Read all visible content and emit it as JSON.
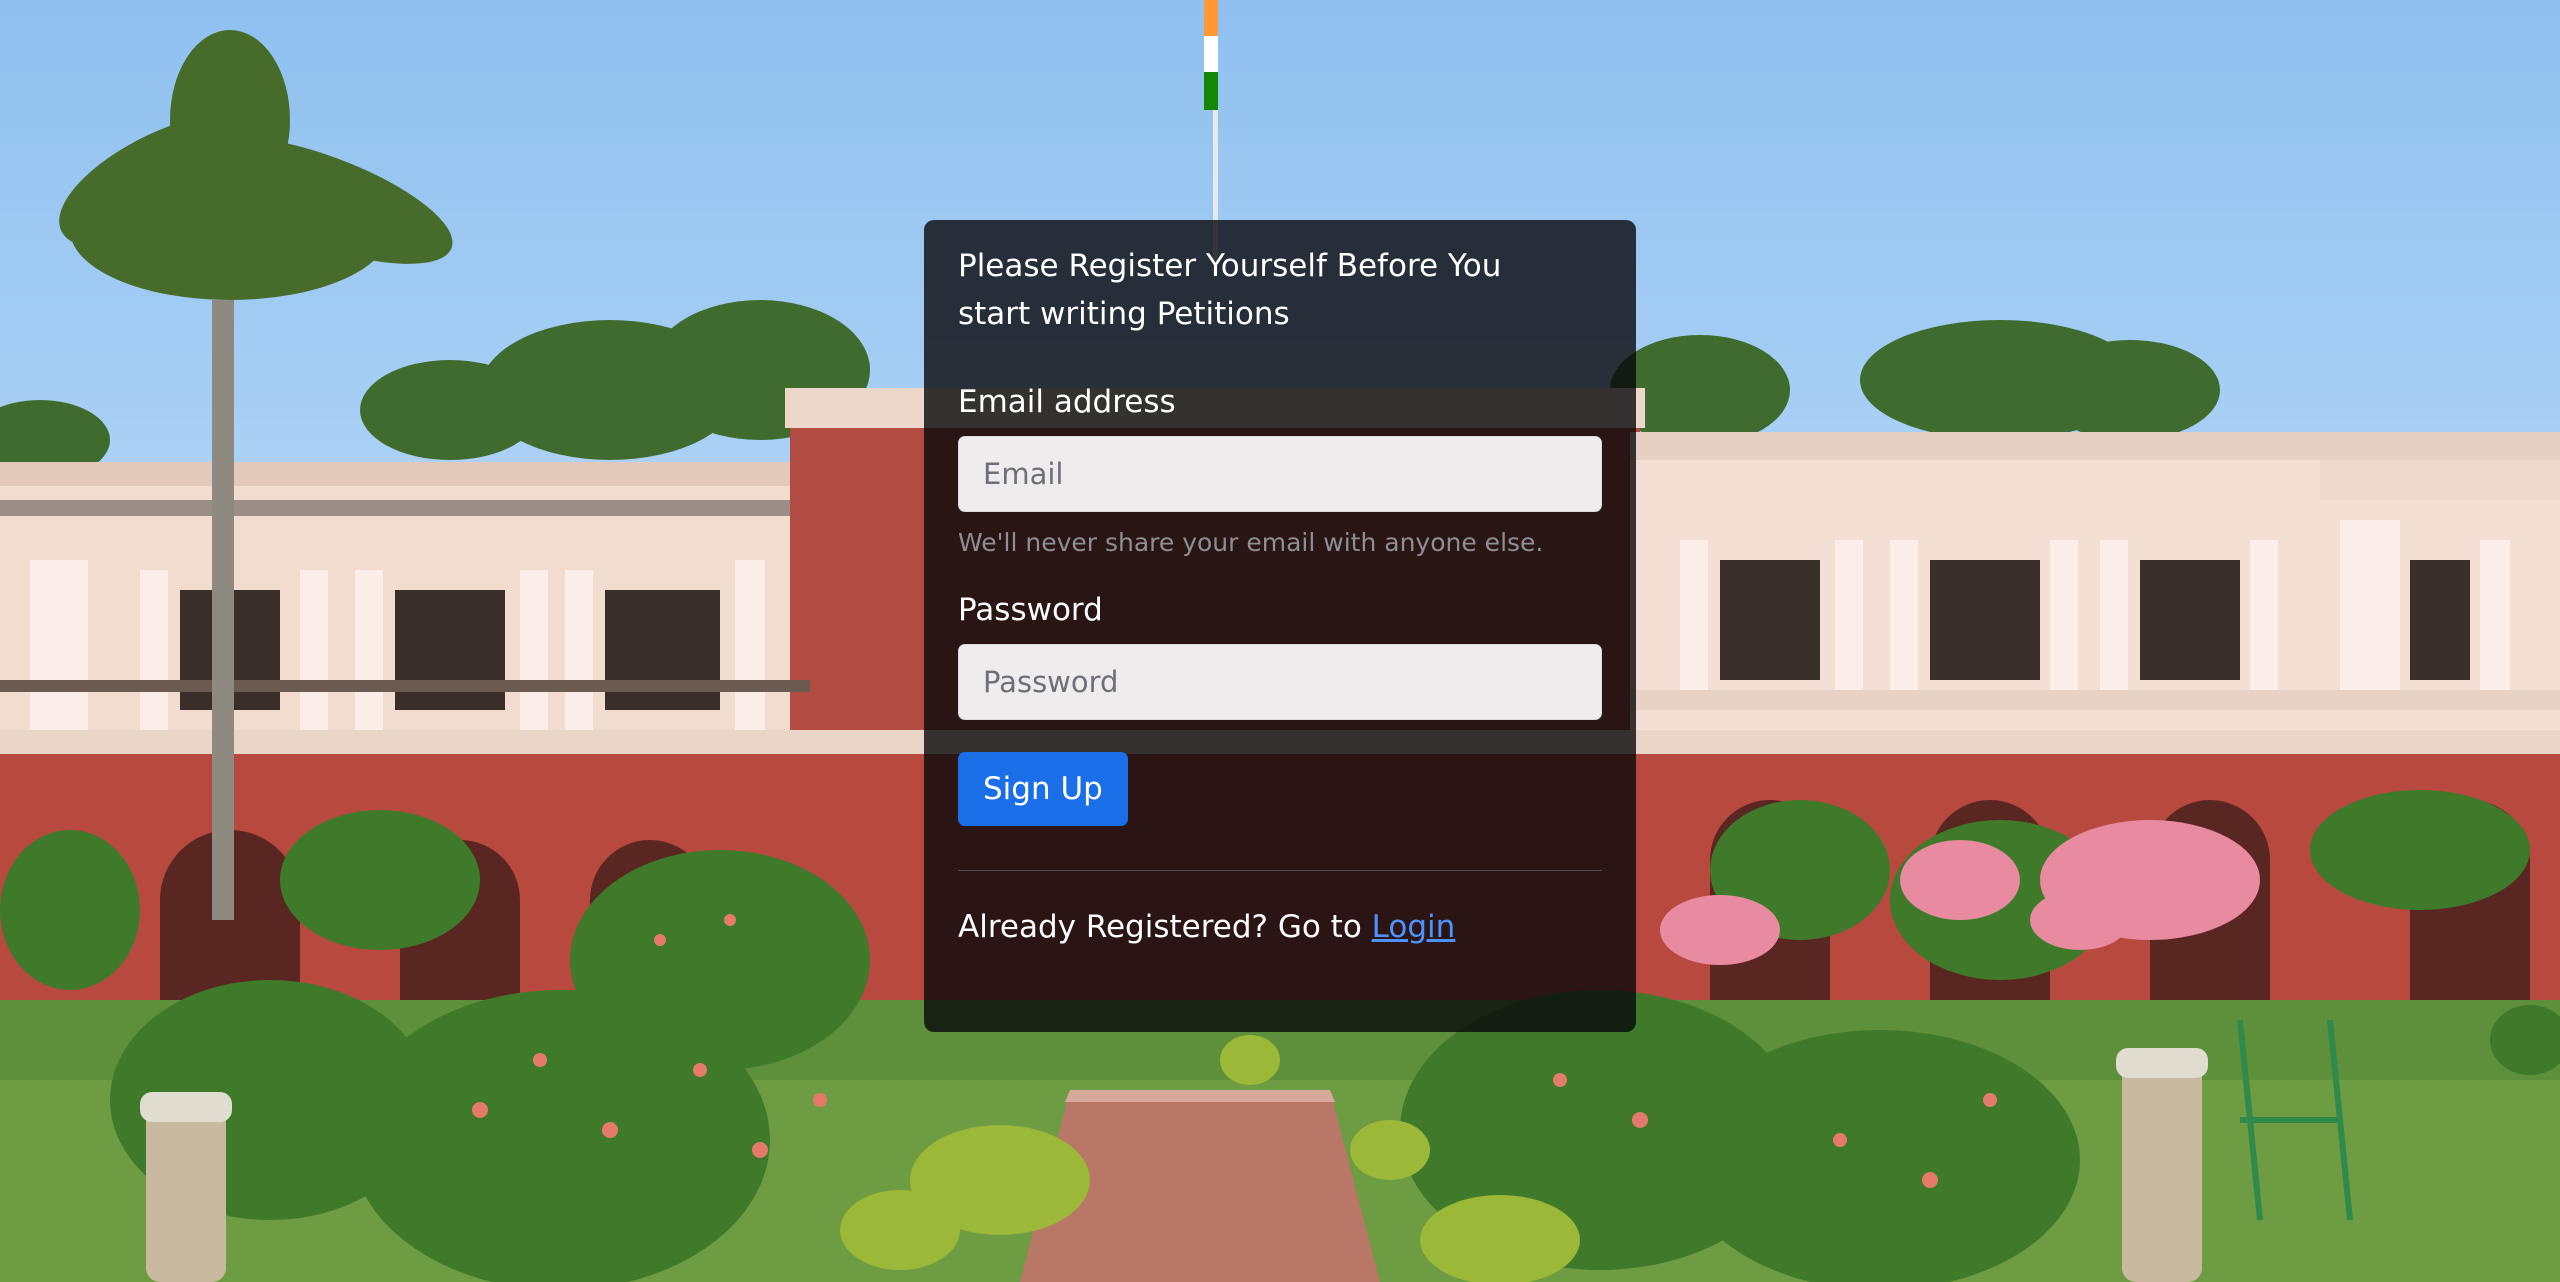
{
  "card": {
    "heading": "Please Register Yourself Before You start writing Petitions"
  },
  "form": {
    "email_label": "Email address",
    "email_placeholder": "Email",
    "email_value": "",
    "email_help": "We'll never share your email with anyone else.",
    "password_label": "Password",
    "password_placeholder": "Password",
    "password_value": "",
    "submit_label": "Sign Up"
  },
  "footer": {
    "prompt": "Already Registered? Go to",
    "login_link": "Login"
  },
  "colors": {
    "button_primary": "#1a6ee8",
    "link": "#4d93ff",
    "card_background": "rgba(8,8,10,0.80)"
  }
}
